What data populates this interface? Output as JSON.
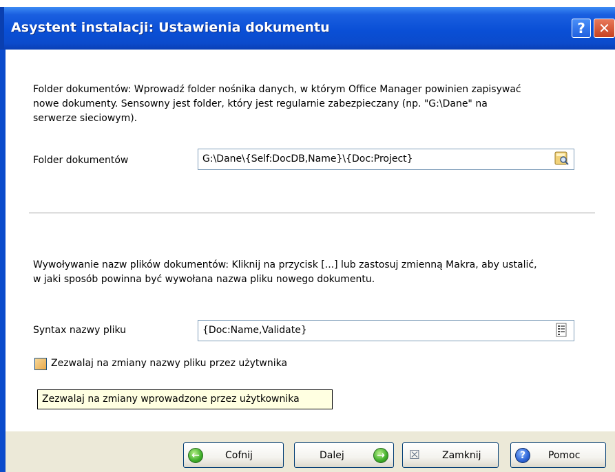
{
  "window": {
    "title": "Asystent instalacji: Ustawienia dokumentu",
    "help_label": "?",
    "close_label": "✕"
  },
  "section1": {
    "description_line1": "Folder dokumentów: Wprowadź folder nośnika danych, w którym Office Manager powinien zapisywać",
    "description_line2": "nowe dokumenty. Sensowny jest folder, który jest regularnie zabezpieczany (np. \"G:\\Dane\" na",
    "description_line3": "serwerze sieciowym).",
    "field_label": "Folder dokumentów",
    "field_value": "G:\\Dane\\{Self:DocDB,Name}\\{Doc:Project}",
    "field_icon": "browse-folder-icon"
  },
  "section2": {
    "description_line1": "Wywoływanie nazw plików dokumentów: Kliknij na przycisk [...] lub zastosuj zmienną Makra, aby ustalić,",
    "description_line2": "w jaki sposób powinna być wywołana nazwa pliku nowego dokumentu.",
    "field_label": "Syntax nazwy pliku",
    "field_value": "{Doc:Name,Validate}",
    "field_icon": "macro-list-icon",
    "checkbox_label": "Zezwalaj na zmiany nazwy pliku przez użytwnika",
    "checkbox_checked": false,
    "tooltip": "Zezwalaj na zmiany wprowadzone przez użytkownika"
  },
  "buttons": {
    "back": "Cofnij",
    "next": "Dalej",
    "close": "Zamknij",
    "help": "Pomoc"
  }
}
